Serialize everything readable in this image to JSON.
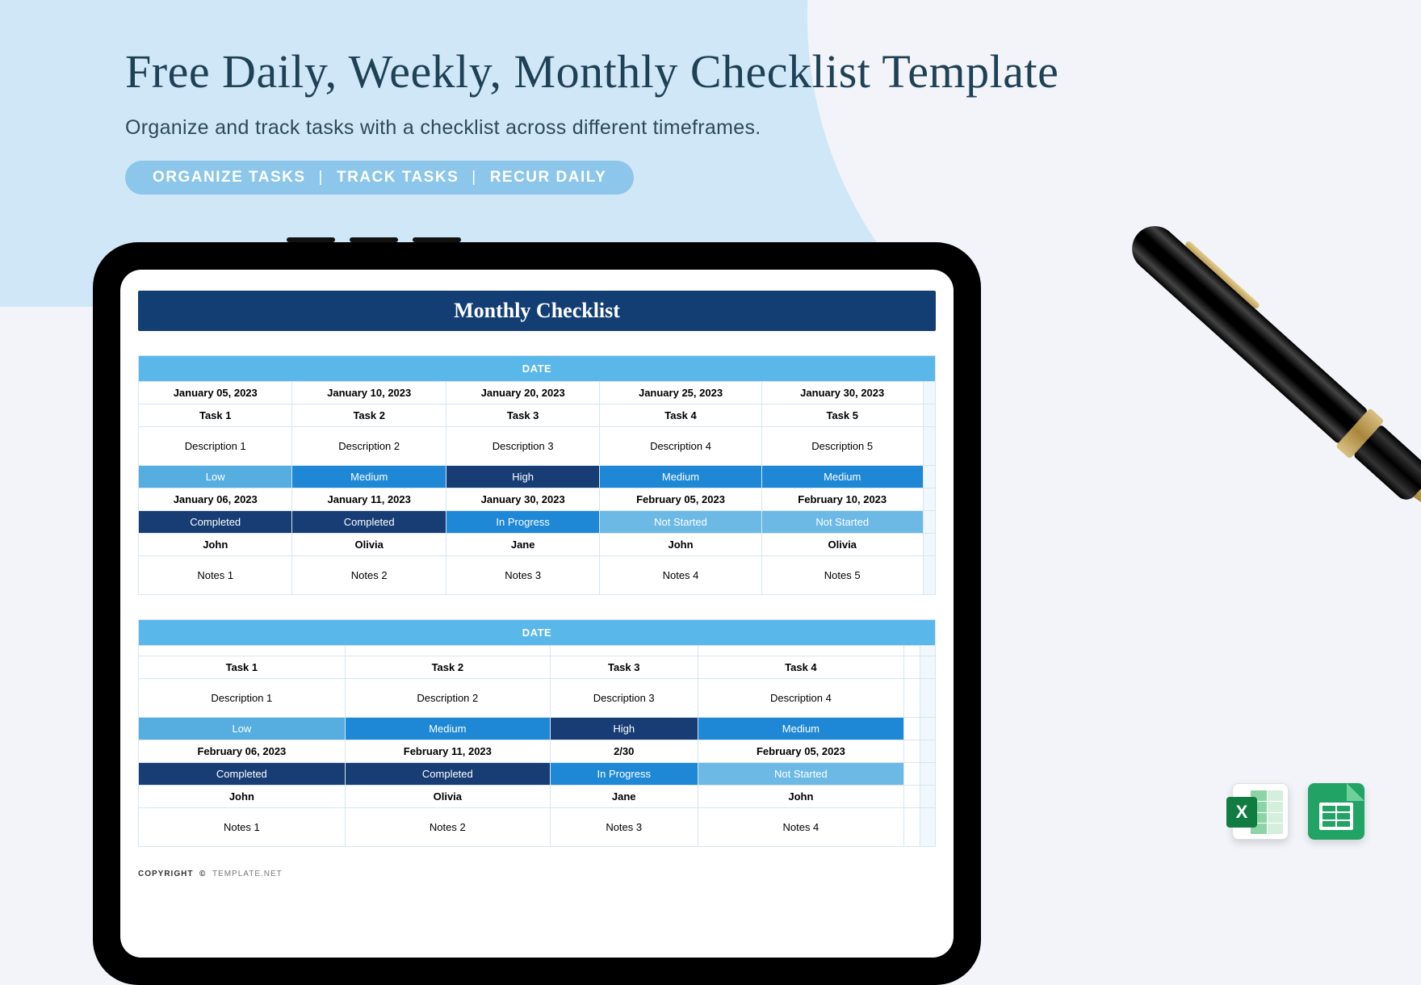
{
  "hero": {
    "title": "Free Daily, Weekly, Monthly Checklist Template",
    "subtitle": "Organize and track tasks with a checklist across different timeframes.",
    "pill": [
      "ORGANIZE TASKS",
      "TRACK TASKS",
      "RECUR DAILY"
    ]
  },
  "sheet": {
    "title": "Monthly Checklist",
    "copyright_label": "COPYRIGHT",
    "copyright_symbol": "©",
    "copyright_owner": "TEMPLATE.NET"
  },
  "chart_data": [
    {
      "type": "table",
      "title": "DATE",
      "categories": [
        "January 05, 2023",
        "January 10, 2023",
        "January 20, 2023",
        "January 25, 2023",
        "January 30, 2023",
        ""
      ],
      "rows": {
        "task": [
          "Task 1",
          "Task 2",
          "Task 3",
          "Task 4",
          "Task 5",
          ""
        ],
        "description": [
          "Description 1",
          "Description 2",
          "Description 3",
          "Description 4",
          "Description 5",
          ""
        ],
        "priority": [
          "Low",
          "Medium",
          "High",
          "Medium",
          "Medium",
          ""
        ],
        "due": [
          "January 06, 2023",
          "January 11, 2023",
          "January 30, 2023",
          "February 05, 2023",
          "February 10, 2023",
          ""
        ],
        "status": [
          "Completed",
          "Completed",
          "In Progress",
          "Not Started",
          "Not Started",
          ""
        ],
        "owner": [
          "John",
          "Olivia",
          "Jane",
          "John",
          "Olivia",
          ""
        ],
        "notes": [
          "Notes 1",
          "Notes 2",
          "Notes 3",
          "Notes 4",
          "Notes 5",
          ""
        ]
      }
    },
    {
      "type": "table",
      "title": "DATE",
      "categories": [
        "",
        "",
        "",
        "",
        "",
        ""
      ],
      "rows": {
        "task": [
          "Task 1",
          "Task 2",
          "Task 3",
          "Task 4",
          "",
          ""
        ],
        "description": [
          "Description 1",
          "Description 2",
          "Description 3",
          "Description 4",
          "",
          ""
        ],
        "priority": [
          "Low",
          "Medium",
          "High",
          "Medium",
          "",
          ""
        ],
        "due": [
          "February 06, 2023",
          "February 11, 2023",
          "2/30",
          "February 05, 2023",
          "",
          ""
        ],
        "status": [
          "Completed",
          "Completed",
          "In Progress",
          "Not Started",
          "",
          ""
        ],
        "owner": [
          "John",
          "Olivia",
          "Jane",
          "John",
          "",
          ""
        ],
        "notes": [
          "Notes 1",
          "Notes 2",
          "Notes 3",
          "Notes 4",
          "",
          ""
        ]
      }
    }
  ],
  "apps": {
    "excel": "Excel",
    "sheets": "Google Sheets"
  }
}
